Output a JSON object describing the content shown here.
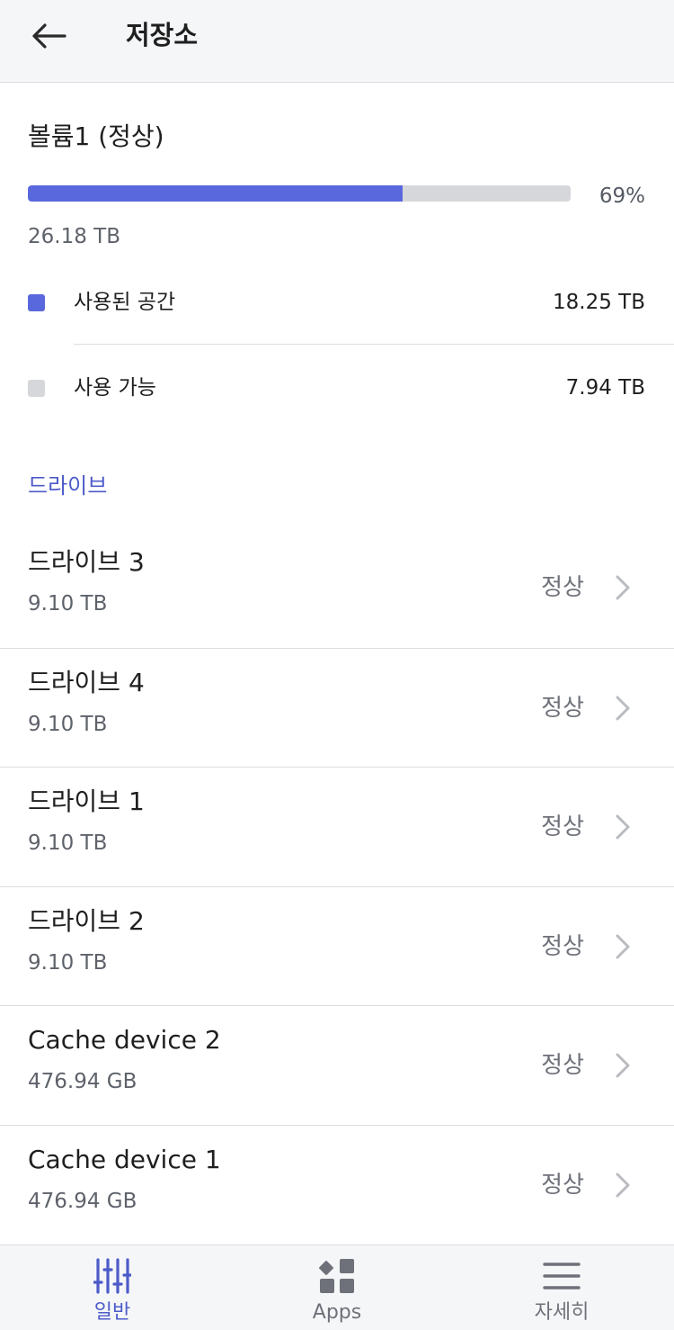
{
  "header": {
    "title": "저장소"
  },
  "volume": {
    "title": "볼륨1 (정상)",
    "usage_percent_label": "69%",
    "usage_fraction": 0.69,
    "total_size": "26.18 TB",
    "legend": [
      {
        "label": "사용된 공간",
        "value": "18.25 TB",
        "color": "#5a68dd"
      },
      {
        "label": "사용 가능",
        "value": "7.94 TB",
        "color": "#d6d7da"
      }
    ]
  },
  "drives_section": {
    "header": "드라이브",
    "items": [
      {
        "name": "드라이브 3",
        "size": "9.10 TB",
        "status": "정상"
      },
      {
        "name": "드라이브 4",
        "size": "9.10 TB",
        "status": "정상"
      },
      {
        "name": "드라이브 1",
        "size": "9.10 TB",
        "status": "정상"
      },
      {
        "name": "드라이브 2",
        "size": "9.10 TB",
        "status": "정상"
      },
      {
        "name": "Cache device 2",
        "size": "476.94 GB",
        "status": "정상"
      },
      {
        "name": "Cache device 1",
        "size": "476.94 GB",
        "status": "정상"
      }
    ]
  },
  "bottom_nav": {
    "items": [
      {
        "label": "일반",
        "icon": "sliders-icon",
        "active": true
      },
      {
        "label": "Apps",
        "icon": "apps-grid-icon",
        "active": false
      },
      {
        "label": "자세히",
        "icon": "menu-icon",
        "active": false
      }
    ]
  },
  "colors": {
    "accent": "#4d5bc9",
    "used": "#5a68dd",
    "available": "#d6d7da"
  }
}
